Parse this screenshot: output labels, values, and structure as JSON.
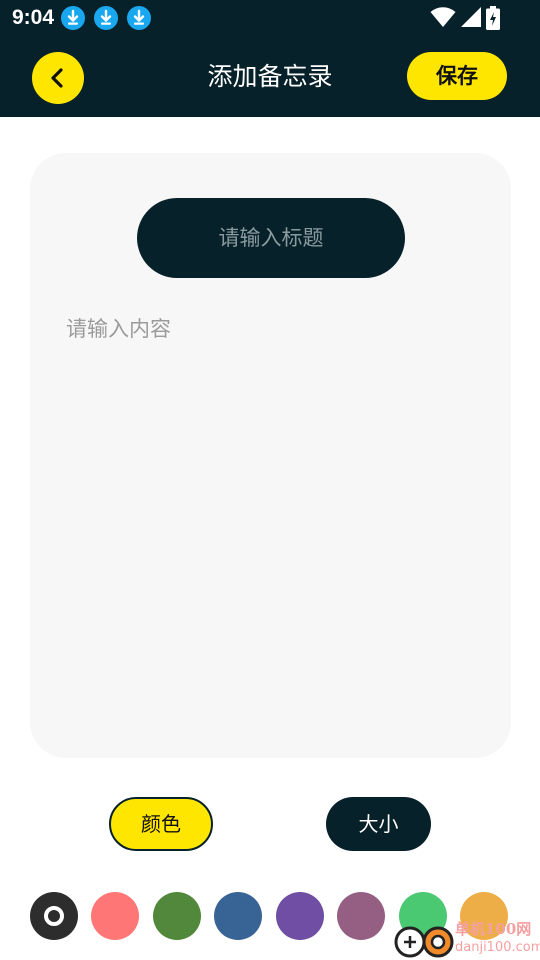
{
  "status_bar": {
    "time": "9:04",
    "notification_icons": [
      "download-icon",
      "download-icon",
      "download-icon"
    ]
  },
  "header": {
    "back_icon": "chevron-left-icon",
    "title": "添加备忘录",
    "save_label": "保存"
  },
  "editor": {
    "title_placeholder": "请输入标题",
    "content_placeholder": "请输入内容"
  },
  "controls": {
    "color_label": "颜色",
    "size_label": "大小"
  },
  "swatches": [
    {
      "color": "#2d2d2d",
      "selected": true
    },
    {
      "color": "#ff7676",
      "selected": false
    },
    {
      "color": "#51883b",
      "selected": false
    },
    {
      "color": "#376494",
      "selected": false
    },
    {
      "color": "#6f4ea4",
      "selected": false
    },
    {
      "color": "#955e83",
      "selected": false
    },
    {
      "color": "#4bc872",
      "selected": false
    },
    {
      "color": "#edae48",
      "selected": false
    }
  ],
  "watermark": {
    "line1": "单机100网",
    "line2": "danji100.com"
  },
  "colors": {
    "accent": "#ffe600",
    "dark": "#06212a",
    "card": "#f7f7f7"
  }
}
